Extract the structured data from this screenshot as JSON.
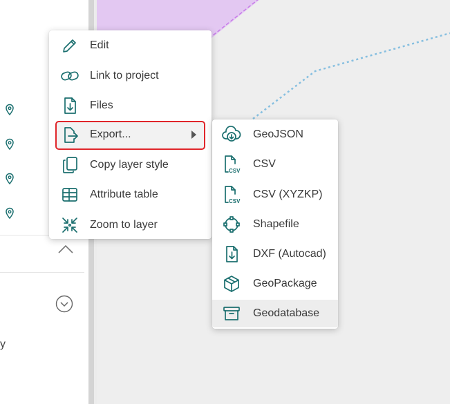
{
  "left_panel": {
    "partial_text": "y"
  },
  "context_menu": {
    "items": [
      {
        "label": "Edit",
        "icon": "pencil-icon"
      },
      {
        "label": "Link to project",
        "icon": "link-icon"
      },
      {
        "label": "Files",
        "icon": "file-download-icon"
      },
      {
        "label": "Export...",
        "icon": "export-icon",
        "has_submenu": true,
        "highlighted": true
      },
      {
        "label": "Copy layer style",
        "icon": "copy-icon"
      },
      {
        "label": "Attribute table",
        "icon": "table-icon"
      },
      {
        "label": "Zoom to layer",
        "icon": "zoom-to-layer-icon"
      }
    ]
  },
  "export_submenu": {
    "items": [
      {
        "label": "GeoJSON",
        "icon": "cloud-download-icon"
      },
      {
        "label": "CSV",
        "icon": "csv-file-icon"
      },
      {
        "label": "CSV (XYZKP)",
        "icon": "csv-file-icon"
      },
      {
        "label": "Shapefile",
        "icon": "shapefile-icon"
      },
      {
        "label": "DXF (Autocad)",
        "icon": "dxf-file-icon"
      },
      {
        "label": "GeoPackage",
        "icon": "geopackage-icon"
      },
      {
        "label": "Geodatabase",
        "icon": "archive-icon",
        "hovered": true
      }
    ]
  },
  "colors": {
    "icon_teal": "#1b6f6f",
    "highlight_border": "#e0252a",
    "polygon_fill": "#e3c8f2",
    "polygon_stroke": "#c77ce8",
    "dashed_line": "#86bfe0",
    "map_background": "#eeeeee"
  }
}
